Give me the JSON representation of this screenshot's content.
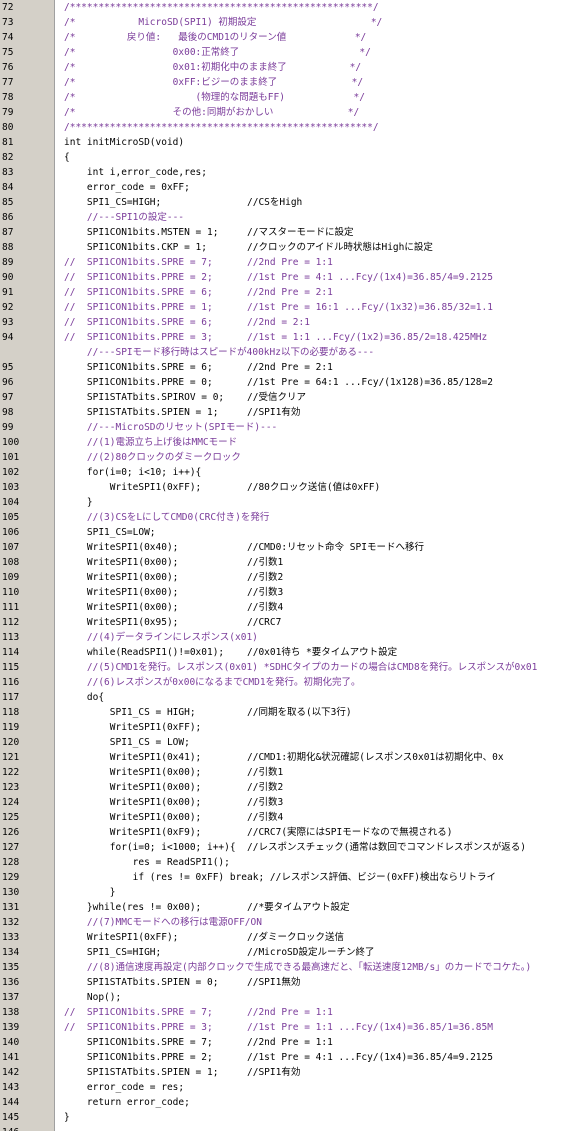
{
  "editor": {
    "lines": [
      {
        "n": "72",
        "t": "/*****************************************************/"
      },
      {
        "n": "73",
        "t": "/*           MicroSD(SPI1) 初期設定                    */"
      },
      {
        "n": "74",
        "t": "/*         戻り値:   最後のCMD1のリターン値            */"
      },
      {
        "n": "75",
        "t": "/*                 0x00:正常終了                     */"
      },
      {
        "n": "76",
        "t": "/*                 0x01:初期化中のまま終了           */"
      },
      {
        "n": "77",
        "t": "/*                 0xFF:ビジーのまま終了             */"
      },
      {
        "n": "78",
        "t": "/*                     (物理的な問題もFF)            */"
      },
      {
        "n": "79",
        "t": "/*                 その他:同期がおかしい             */"
      },
      {
        "n": "80",
        "t": "/*****************************************************/"
      },
      {
        "n": "81",
        "t": "int initMicroSD(void)"
      },
      {
        "n": "82",
        "t": "{"
      },
      {
        "n": "83",
        "t": "    int i,error_code,res;"
      },
      {
        "n": "84",
        "t": "    error_code = 0xFF;"
      },
      {
        "n": "85",
        "t": "    SPI1_CS=HIGH;               //CSをHigh"
      },
      {
        "n": "86",
        "t": "    //---SPI1の設定---"
      },
      {
        "n": "87",
        "t": "    SPI1CON1bits.MSTEN = 1;     //マスターモードに設定"
      },
      {
        "n": "88",
        "t": "    SPI1CON1bits.CKP = 1;       //クロックのアイドル時状態はHighに設定"
      },
      {
        "n": "89",
        "t": "//  SPI1CON1bits.SPRE = 7;      //2nd Pre = 1:1"
      },
      {
        "n": "90",
        "t": "//  SPI1CON1bits.PPRE = 2;      //1st Pre = 4:1 ...Fcy/(1x4)=36.85/4=9.2125"
      },
      {
        "n": "91",
        "t": "//  SPI1CON1bits.SPRE = 6;      //2nd Pre = 2:1"
      },
      {
        "n": "92",
        "t": "//  SPI1CON1bits.PPRE = 1;      //1st Pre = 16:1 ...Fcy/(1x32)=36.85/32=1.1"
      },
      {
        "n": "93",
        "t": "//  SPI1CON1bits.SPRE = 6;      //2nd = 2:1"
      },
      {
        "n": "94",
        "t": "//  SPI1CON1bits.PPRE = 3;      //1st = 1:1 ...Fcy/(1x2)=36.85/2=18.425MHz"
      },
      {
        "n": "",
        "t": "    //---SPIモード移行時はスピードが400kHz以下の必要がある---"
      },
      {
        "n": "95",
        "t": "    SPI1CON1bits.SPRE = 6;      //2nd Pre = 2:1"
      },
      {
        "n": "96",
        "t": "    SPI1CON1bits.PPRE = 0;      //1st Pre = 64:1 ...Fcy/(1x128)=36.85/128=2"
      },
      {
        "n": "97",
        "t": "    SPI1STATbits.SPIROV = 0;    //受信クリア"
      },
      {
        "n": "98",
        "t": "    SPI1STATbits.SPIEN = 1;     //SPI1有効"
      },
      {
        "n": "99",
        "t": "    //---MicroSDのリセット(SPIモード)---"
      },
      {
        "n": "100",
        "t": "    //(1)電源立ち上げ後はMMCモード"
      },
      {
        "n": "101",
        "t": "    //(2)80クロックのダミークロック"
      },
      {
        "n": "102",
        "t": "    for(i=0; i<10; i++){"
      },
      {
        "n": "103",
        "t": "        WriteSPI1(0xFF);        //80クロック送信(値は0xFF)"
      },
      {
        "n": "104",
        "t": "    }"
      },
      {
        "n": "105",
        "t": "    //(3)CSをLにしてCMD0(CRC付き)を発行"
      },
      {
        "n": "106",
        "t": "    SPI1_CS=LOW;"
      },
      {
        "n": "107",
        "t": "    WriteSPI1(0x40);            //CMD0:リセット命令 SPIモードへ移行"
      },
      {
        "n": "108",
        "t": "    WriteSPI1(0x00);            //引数1"
      },
      {
        "n": "109",
        "t": "    WriteSPI1(0x00);            //引数2"
      },
      {
        "n": "110",
        "t": "    WriteSPI1(0x00);            //引数3"
      },
      {
        "n": "111",
        "t": "    WriteSPI1(0x00);            //引数4"
      },
      {
        "n": "112",
        "t": "    WriteSPI1(0x95);            //CRC7"
      },
      {
        "n": "113",
        "t": "    //(4)データラインにレスポンス(x01)"
      },
      {
        "n": "114",
        "t": "    while(ReadSPI1()!=0x01);    //0x01待ち *要タイムアウト設定"
      },
      {
        "n": "115",
        "t": "    //(5)CMD1を発行。レスポンス(0x01) *SDHCタイプのカードの場合はCMD8を発行。レスポンスが0x01"
      },
      {
        "n": "116",
        "t": "    //(6)レスポンスが0x00になるまでCMD1を発行。初期化完了。"
      },
      {
        "n": "117",
        "t": "    do{"
      },
      {
        "n": "118",
        "t": "        SPI1_CS = HIGH;         //同期を取る(以下3行)"
      },
      {
        "n": "119",
        "t": "        WriteSPI1(0xFF);"
      },
      {
        "n": "120",
        "t": "        SPI1_CS = LOW;"
      },
      {
        "n": "121",
        "t": "        WriteSPI1(0x41);        //CMD1:初期化&状況確認(レスポンス0x01は初期化中、0x"
      },
      {
        "n": "122",
        "t": "        WriteSPI1(0x00);        //引数1"
      },
      {
        "n": "123",
        "t": "        WriteSPI1(0x00);        //引数2"
      },
      {
        "n": "124",
        "t": "        WriteSPI1(0x00);        //引数3"
      },
      {
        "n": "125",
        "t": "        WriteSPI1(0x00);        //引数4"
      },
      {
        "n": "126",
        "t": "        WriteSPI1(0xF9);        //CRC7(実際にはSPIモードなので無視される)"
      },
      {
        "n": "127",
        "t": "        for(i=0; i<1000; i++){  //レスポンスチェック(通常は数回でコマンドレスポンスが返る)"
      },
      {
        "n": "128",
        "t": "            res = ReadSPI1();"
      },
      {
        "n": "129",
        "t": "            if (res != 0xFF) break; //レスポンス評価、ビジー(0xFF)検出ならリトライ"
      },
      {
        "n": "130",
        "t": "        }"
      },
      {
        "n": "131",
        "t": "    }while(res != 0x00);        //*要タイムアウト設定"
      },
      {
        "n": "132",
        "t": "    //(7)MMCモードへの移行は電源OFF/ON"
      },
      {
        "n": "133",
        "t": "    WriteSPI1(0xFF);            //ダミークロック送信"
      },
      {
        "n": "134",
        "t": "    SPI1_CS=HIGH;               //MicroSD設定ルーチン終了"
      },
      {
        "n": "135",
        "t": "    //(8)通信速度再設定(内部クロックで生成できる最高速だと、「転送速度12MB/s」のカードでコケた。)"
      },
      {
        "n": "136",
        "t": "    SPI1STATbits.SPIEN = 0;     //SPI1無効"
      },
      {
        "n": "137",
        "t": "    Nop();"
      },
      {
        "n": "138",
        "t": "//  SPI1CON1bits.SPRE = 7;      //2nd Pre = 1:1"
      },
      {
        "n": "139",
        "t": "//  SPI1CON1bits.PPRE = 3;      //1st Pre = 1:1 ...Fcy/(1x4)=36.85/1=36.85M"
      },
      {
        "n": "140",
        "t": "    SPI1CON1bits.SPRE = 7;      //2nd Pre = 1:1"
      },
      {
        "n": "141",
        "t": "    SPI1CON1bits.PPRE = 2;      //1st Pre = 4:1 ...Fcy/(1x4)=36.85/4=9.2125"
      },
      {
        "n": "142",
        "t": "    SPI1STATbits.SPIEN = 1;     //SPI1有効"
      },
      {
        "n": "143",
        "t": "    error_code = res;"
      },
      {
        "n": "144",
        "t": "    return error_code;"
      },
      {
        "n": "145",
        "t": "}"
      },
      {
        "n": "146",
        "t": ""
      }
    ]
  }
}
